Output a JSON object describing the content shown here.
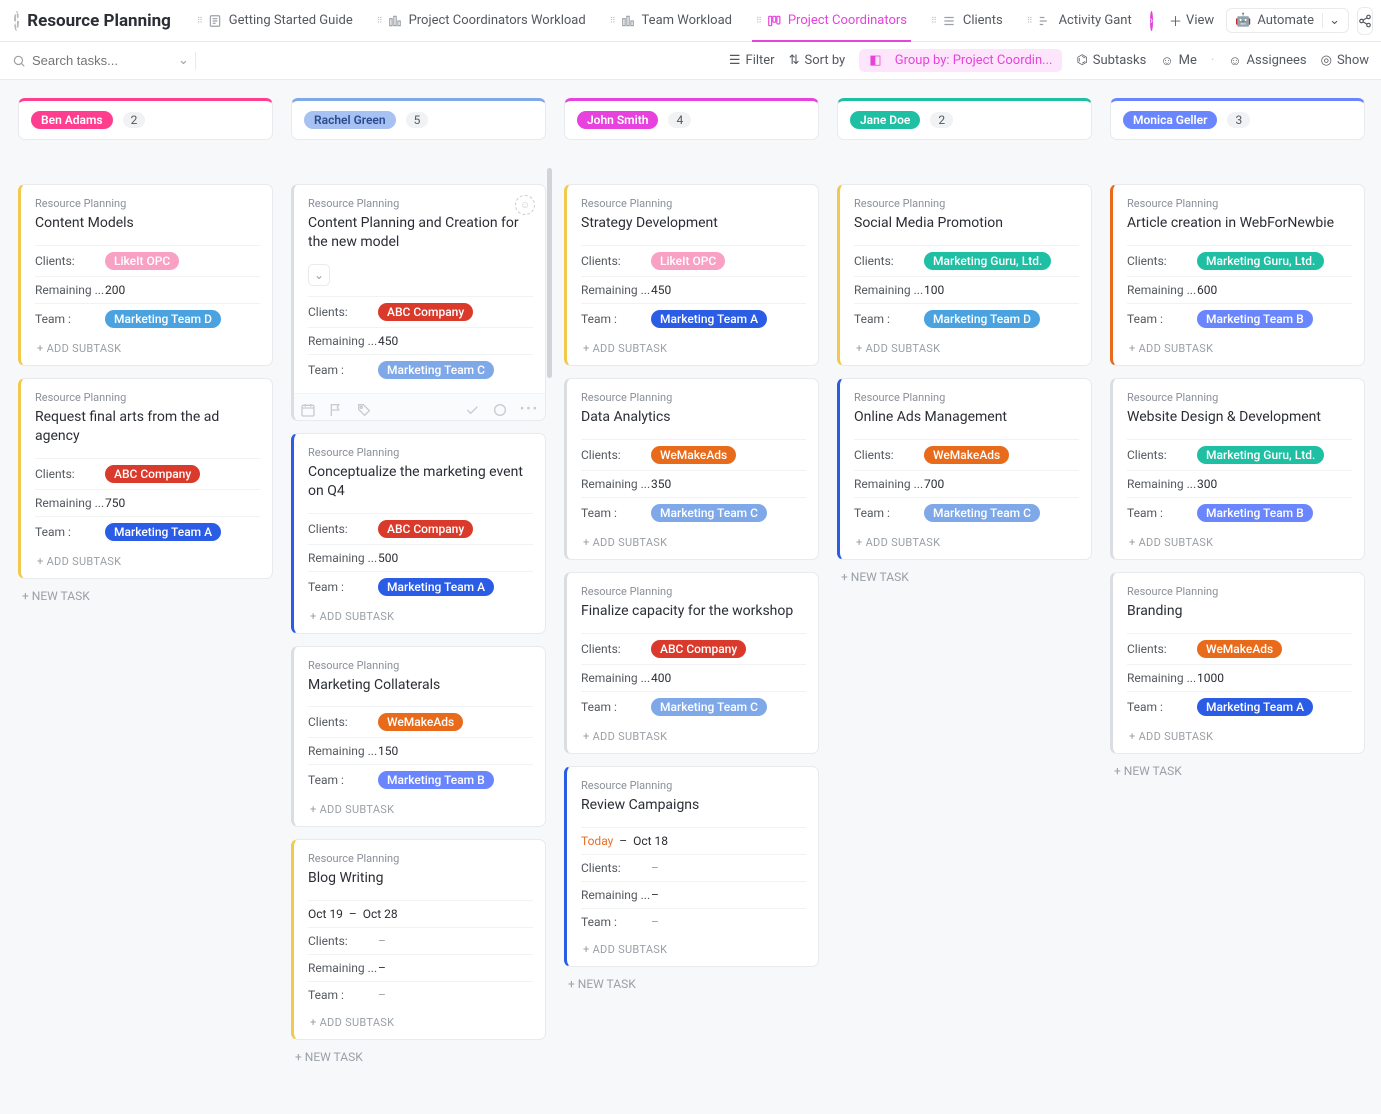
{
  "header": {
    "title": "Resource Planning",
    "tabs": [
      {
        "label": "Getting Started Guide"
      },
      {
        "label": "Project Coordinators Workload"
      },
      {
        "label": "Team Workload"
      },
      {
        "label": "Project Coordinators",
        "active": true
      },
      {
        "label": "Clients"
      },
      {
        "label": "Activity Gant"
      }
    ],
    "add_view": "View",
    "automate": "Automate"
  },
  "toolbar": {
    "search_placeholder": "Search tasks...",
    "filter": "Filter",
    "sort": "Sort by",
    "group": "Group by: Project Coordin...",
    "subtasks": "Subtasks",
    "me": "Me",
    "assignees": "Assignees",
    "show": "Show"
  },
  "field_labels": {
    "clients": "Clients:",
    "remaining": "Remaining ...",
    "team": "Team :",
    "add_subtask": "+ ADD SUBTASK",
    "new_task": "+ NEW TASK",
    "project": "Resource Planning"
  },
  "client_tags": {
    "likeit": {
      "label": "LikeIt OPC",
      "cls": "t-pink"
    },
    "abc": {
      "label": "ABC Company",
      "cls": "t-red"
    },
    "wemake": {
      "label": "WeMakeAds",
      "cls": "t-orange"
    },
    "guru": {
      "label": "Marketing Guru, Ltd.",
      "cls": "t-teal"
    }
  },
  "team_tags": {
    "a": {
      "label": "Marketing Team A",
      "cls": "t-blue-a"
    },
    "b": {
      "label": "Marketing Team B",
      "cls": "t-blue-b"
    },
    "c": {
      "label": "Marketing Team C",
      "cls": "t-blue-c"
    },
    "d": {
      "label": "Marketing Team D",
      "cls": "t-blue-d"
    }
  },
  "columns": [
    {
      "name": "Ben Adams",
      "count": "2",
      "header_color": "#ff3e8f",
      "pill_bg": "#ff3e8f",
      "pill_fg": "#fff",
      "cards": [
        {
          "title": "Content Models",
          "bar": "#f2c94c",
          "client": "likeit",
          "remaining": "200",
          "team": "d"
        },
        {
          "title": "Request final arts from the ad agency",
          "bar": "#f2c94c",
          "client": "abc",
          "remaining": "750",
          "team": "a"
        }
      ]
    },
    {
      "name": "Rachel Green",
      "count": "5",
      "header_color": "#7fa8e8",
      "pill_bg": "#a7c2f2",
      "pill_fg": "#2a4b8d",
      "cards": [
        {
          "title": "Content Planning and Creation for the new model",
          "bar": "#dadde1",
          "client": "abc",
          "remaining": "450",
          "team": "c",
          "hover": true,
          "assignee": true,
          "subchip": true
        },
        {
          "title": "Conceptualize the marketing event on Q4",
          "bar": "#2b5ce6",
          "client": "abc",
          "remaining": "500",
          "team": "a"
        },
        {
          "title": "Marketing Collaterals",
          "bar": "#dadde1",
          "client": "wemake",
          "remaining": "150",
          "team": "b"
        },
        {
          "title": "Blog Writing",
          "bar": "#f2c94c",
          "dates": {
            "start": "Oct 19",
            "end": "Oct 28"
          },
          "client_dash": true,
          "remaining": "–",
          "team_dash": true
        }
      ]
    },
    {
      "name": "John Smith",
      "count": "4",
      "header_color": "#e742dd",
      "pill_bg": "#e742dd",
      "pill_fg": "#fff",
      "cards": [
        {
          "title": "Strategy Development",
          "bar": "#f2c94c",
          "client": "likeit",
          "remaining": "450",
          "team": "a"
        },
        {
          "title": "Data Analytics",
          "bar": "#dadde1",
          "client": "wemake",
          "remaining": "350",
          "team": "c"
        },
        {
          "title": "Finalize capacity for the workshop",
          "bar": "#dadde1",
          "client": "abc",
          "remaining": "400",
          "team": "c"
        },
        {
          "title": "Review Campaigns",
          "bar": "#2b5ce6",
          "dates": {
            "start": "Today",
            "end": "Oct 18",
            "today": true
          },
          "client_dash": true,
          "remaining": "–",
          "team_dash": true
        }
      ]
    },
    {
      "name": "Jane Doe",
      "count": "2",
      "header_color": "#1fbfa3",
      "pill_bg": "#1fbfa3",
      "pill_fg": "#fff",
      "cards": [
        {
          "title": "Social Media Promotion",
          "bar": "#f2c94c",
          "client": "guru",
          "remaining": "100",
          "team": "d"
        },
        {
          "title": "Online Ads Management",
          "bar": "#2b5ce6",
          "client": "wemake",
          "remaining": "700",
          "team": "c"
        }
      ]
    },
    {
      "name": "Monica Geller",
      "count": "3",
      "header_color": "#6a86ff",
      "pill_bg": "#6a86ff",
      "pill_fg": "#fff",
      "cards": [
        {
          "title": "Article creation in WebForNewbie",
          "bar": "#e86b1c",
          "client": "guru",
          "remaining": "600",
          "team": "b"
        },
        {
          "title": "Website Design & Development",
          "bar": "#dadde1",
          "client": "guru",
          "remaining": "300",
          "team": "b"
        },
        {
          "title": "Branding",
          "bar": "#dadde1",
          "client": "wemake",
          "remaining": "1000",
          "team": "a"
        }
      ]
    }
  ]
}
